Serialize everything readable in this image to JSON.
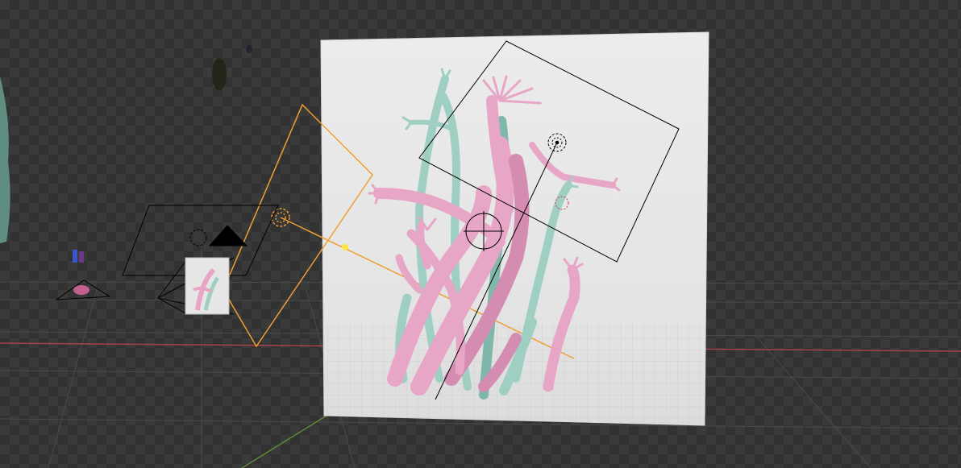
{
  "app": "3D viewport",
  "colors": {
    "viewport_dark": "#323232",
    "viewport_light": "#3a3a3a",
    "grid_line": "#4a4a4a",
    "x_axis": "#a5434a",
    "y_axis": "#5c8a3a",
    "selection_orange": "#f0a030",
    "light_gizmo": "#000000",
    "backdrop": "#e8e8e8",
    "strand_pink": "#e8a6c6",
    "strand_pink_dark": "#d48cb1",
    "strand_mint": "#9fcfc3",
    "strand_mint_dark": "#7fb8aa"
  },
  "objects": [
    {
      "name": "backdrop-plane",
      "type": "mesh",
      "selected": false
    },
    {
      "name": "tentacle-sculpture",
      "type": "mesh",
      "selected": false
    },
    {
      "name": "area-light-selected",
      "type": "light",
      "selected": true
    },
    {
      "name": "area-light-upper-right",
      "type": "light",
      "selected": false
    },
    {
      "name": "area-light-left",
      "type": "light",
      "selected": false
    },
    {
      "name": "camera-small",
      "type": "camera",
      "selected": false
    },
    {
      "name": "camera-preview-thumbnail",
      "type": "image",
      "selected": false
    }
  ]
}
